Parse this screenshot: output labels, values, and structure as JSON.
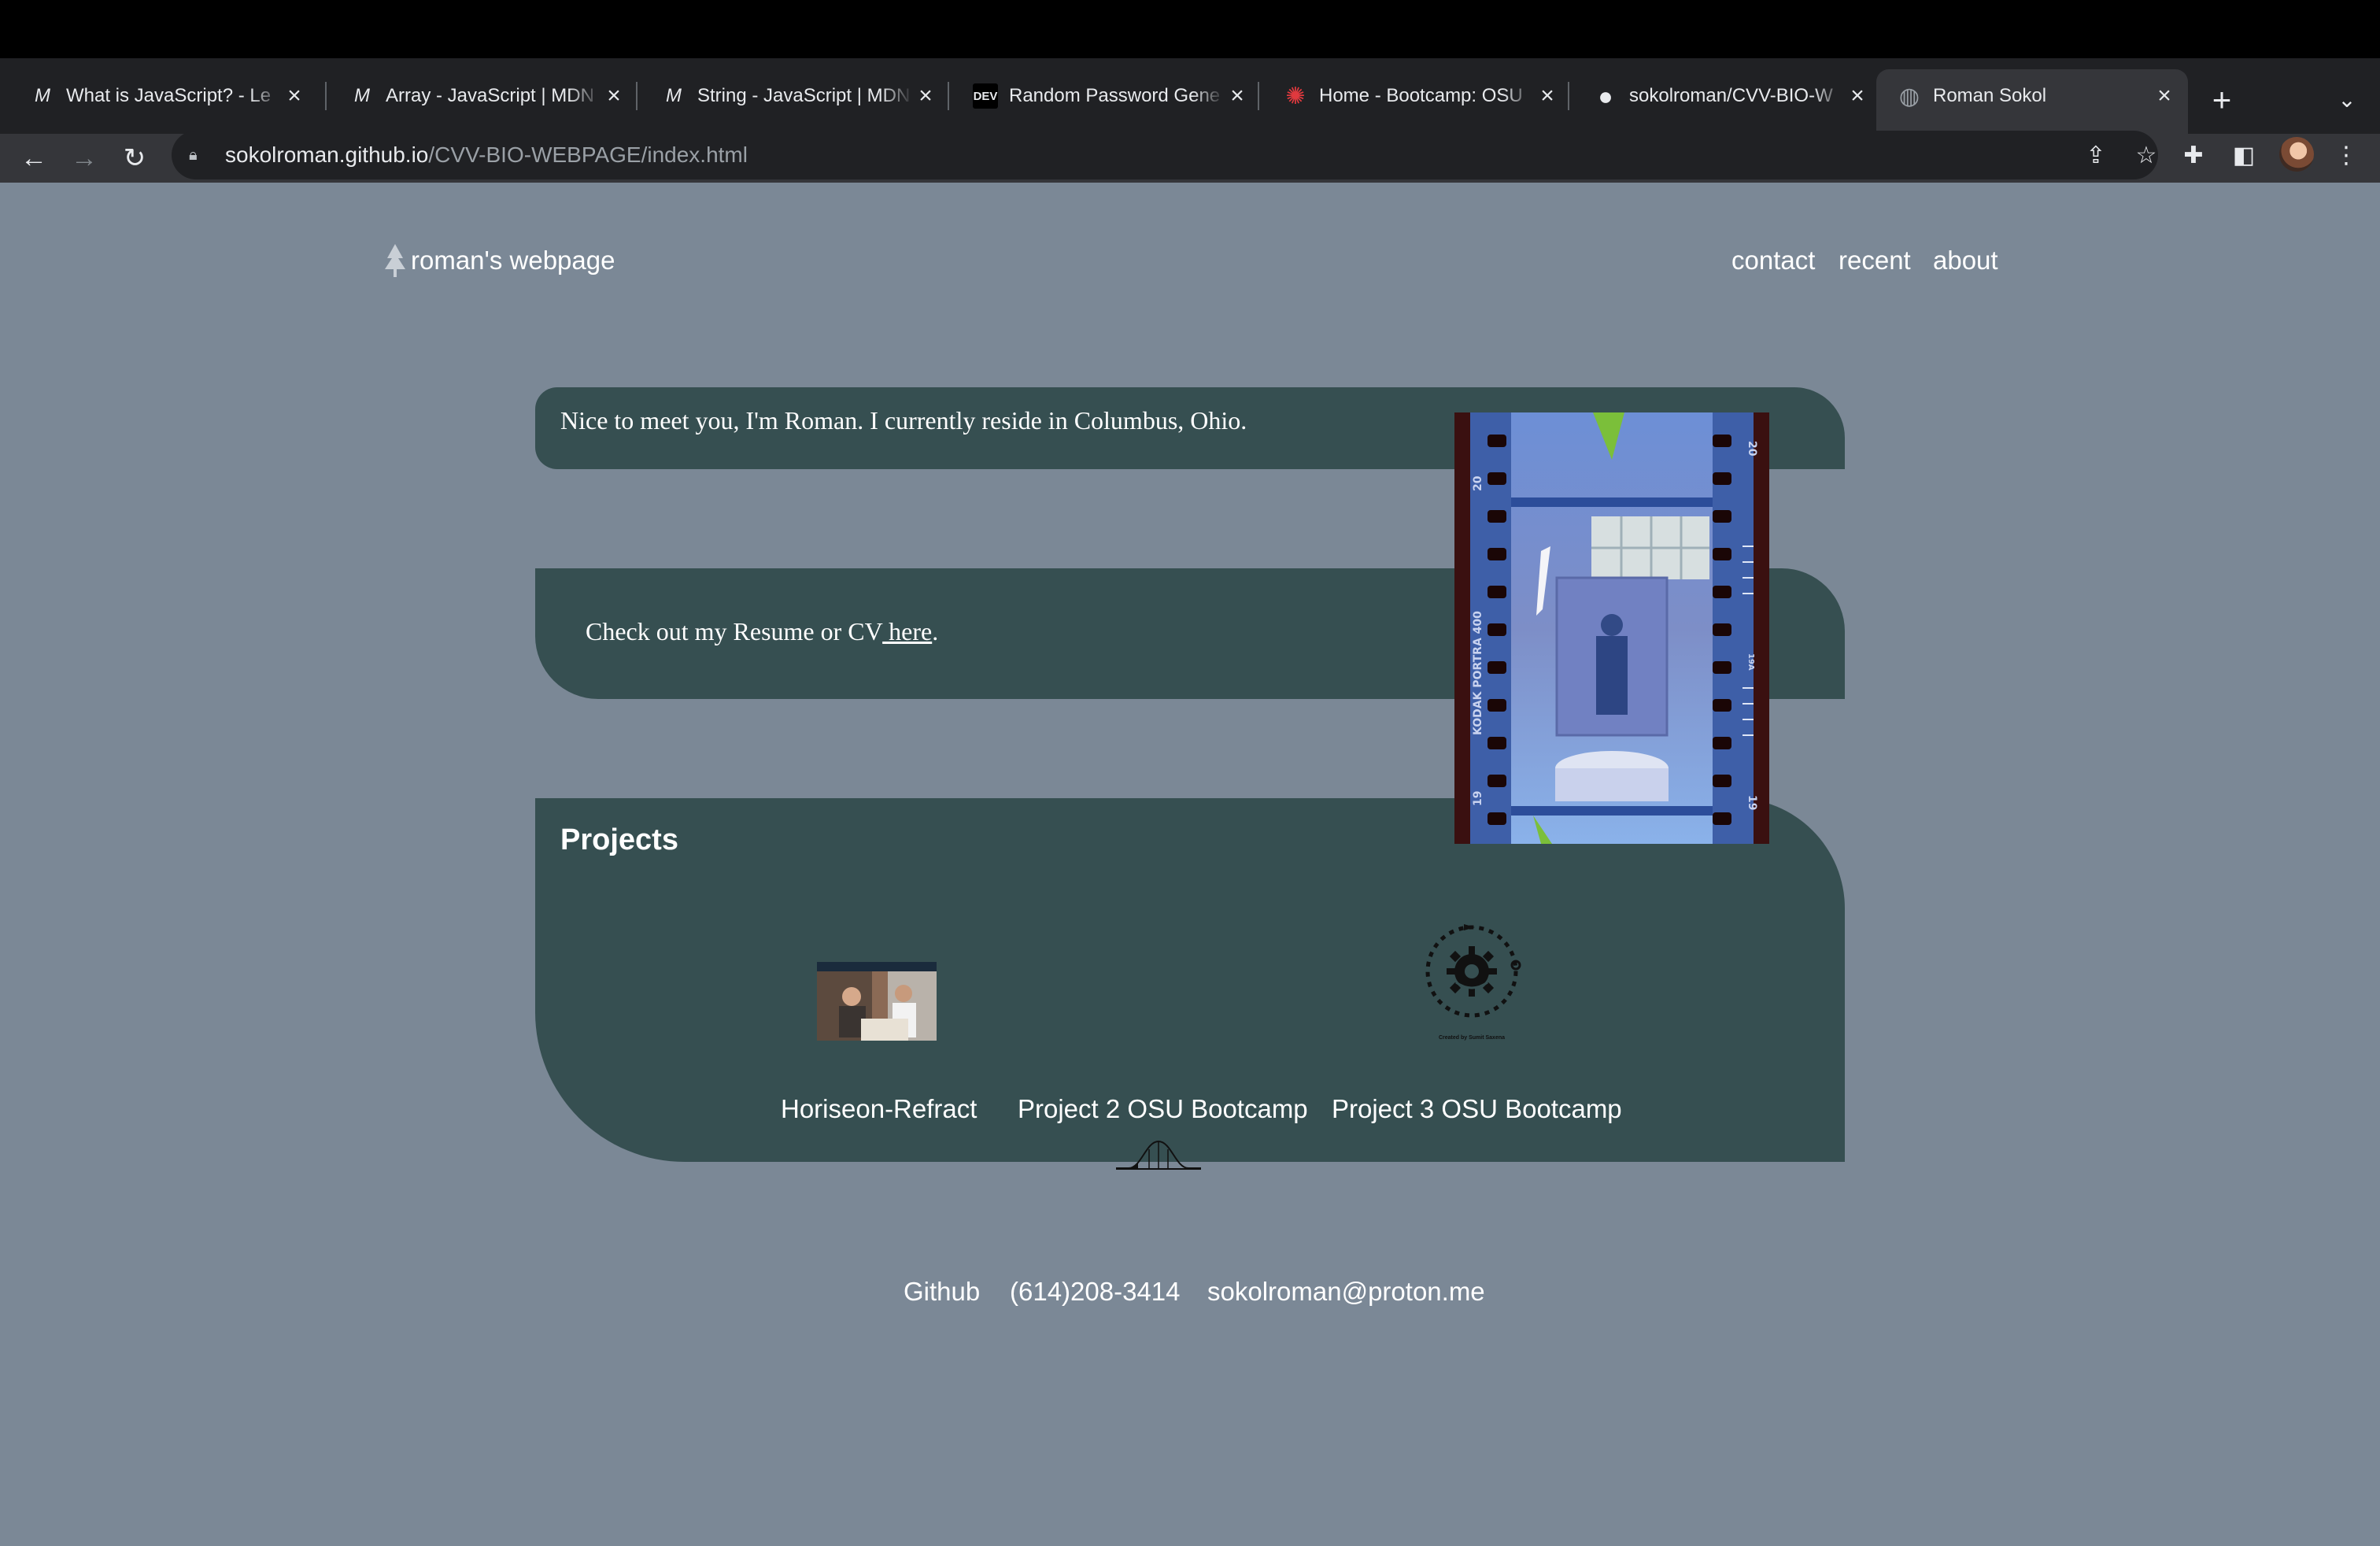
{
  "browser": {
    "tabs": [
      {
        "title": "What is JavaScript? - Le",
        "favicon": "mdn-icon",
        "glyph": "M"
      },
      {
        "title": "Array - JavaScript | MDN",
        "favicon": "mdn-icon",
        "glyph": "M"
      },
      {
        "title": "String - JavaScript | MDN",
        "favicon": "mdn-icon",
        "glyph": "M"
      },
      {
        "title": "Random Password Gene",
        "favicon": "dev-icon",
        "glyph": "DEV"
      },
      {
        "title": "Home - Bootcamp: OSU",
        "favicon": "bootcamp-icon",
        "glyph": "✺"
      },
      {
        "title": "sokolroman/CVV-BIO-W",
        "favicon": "github-icon",
        "glyph": "●"
      },
      {
        "title": "Roman Sokol",
        "favicon": "globe-icon",
        "glyph": "◍"
      }
    ],
    "active_tab_index": 6,
    "url_host": "sokolroman.github.io",
    "url_path": "/CVV-BIO-WEBPAGE/index.html"
  },
  "site": {
    "brand": "roman's webpage",
    "nav": [
      "contact",
      "recent",
      "about"
    ],
    "intro": "Nice to meet you, I'm Roman. I currently reside in Columbus, Ohio.",
    "resume_prefix": "Check out my Resume or CV",
    "resume_link": " here",
    "resume_suffix": ".",
    "projects_heading": "Projects",
    "projects": [
      {
        "label": "Horiseon-Refract"
      },
      {
        "label": "Project 2 OSU Bootcamp"
      },
      {
        "label": "Project 3 OSU Bootcamp",
        "thumb_caption": "Created by Sumit Saxena"
      }
    ],
    "film_marks": {
      "frame_top": "20",
      "frame_bottom": "19",
      "stock": "KODAK PORTRA 400",
      "edge_code": "19A"
    },
    "footer": [
      "Github",
      "(614)208-3414",
      "sokolroman@proton.me"
    ]
  },
  "colors": {
    "page_bg": "#7b8896",
    "panel_bg": "#364f51",
    "chrome_dark": "#202124",
    "chrome_mid": "#35363a"
  }
}
